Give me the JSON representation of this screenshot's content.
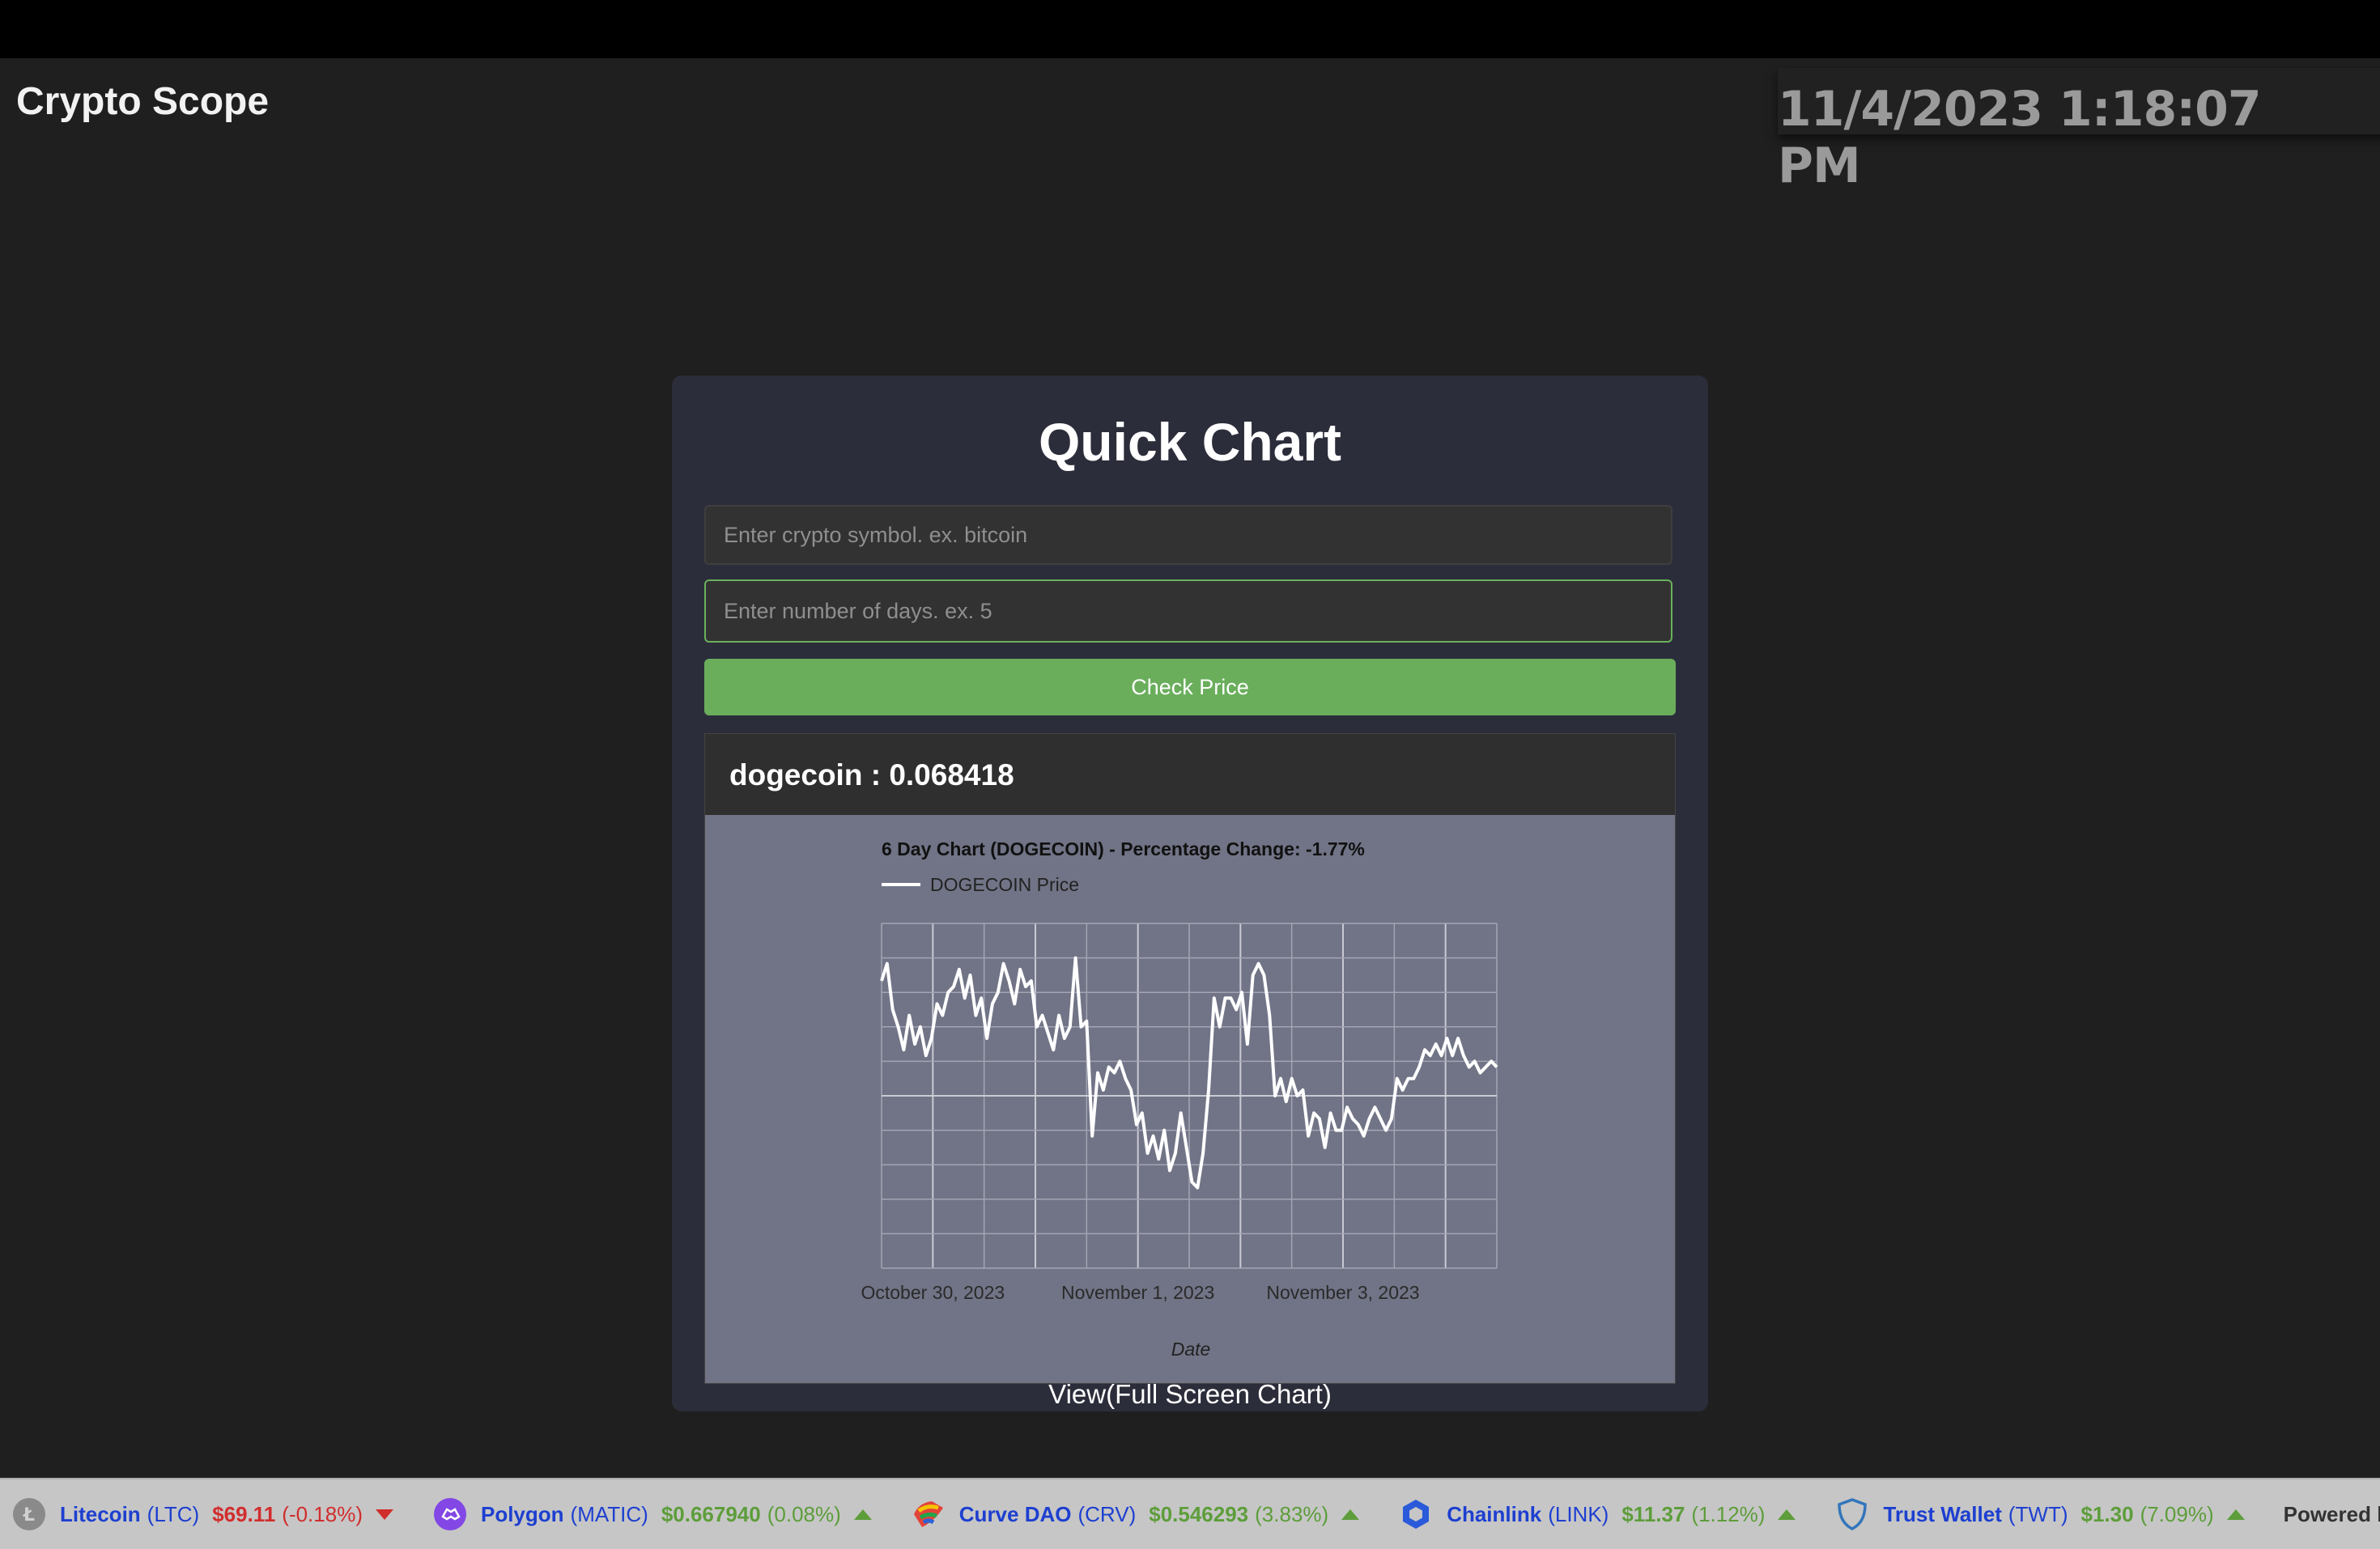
{
  "app": {
    "brand": "Crypto Scope",
    "datetime": "11/4/2023 1:18:07 PM"
  },
  "quick_chart": {
    "title": "Quick Chart",
    "symbol_placeholder": "Enter crypto symbol. ex. bitcoin",
    "days_placeholder": "Enter number of days. ex. 5",
    "check_button": "Check Price",
    "result_text": "dogecoin : 0.068418",
    "fullscreen_link": "View(Full Screen Chart)"
  },
  "chart_data": {
    "type": "line",
    "title": "6 Day Chart (DOGECOIN) - Percentage Change: -1.77%",
    "legend": "DOGECOIN Price",
    "xlabel": "Date",
    "x_ticks": [
      "October 30, 2023",
      "November 1, 2023",
      "November 3, 2023"
    ],
    "series_color": "#ffffff",
    "grid": true,
    "series": [
      {
        "name": "DOGECOIN Price",
        "values": [
          0.07,
          0.0703,
          0.0695,
          0.0692,
          0.0688,
          0.0694,
          0.0689,
          0.0692,
          0.0687,
          0.069,
          0.0696,
          0.0694,
          0.0698,
          0.0699,
          0.0702,
          0.0697,
          0.0701,
          0.0694,
          0.0697,
          0.069,
          0.0696,
          0.0698,
          0.0703,
          0.07,
          0.0696,
          0.0702,
          0.0699,
          0.07,
          0.0692,
          0.0694,
          0.0691,
          0.0688,
          0.0694,
          0.069,
          0.0692,
          0.0704,
          0.0692,
          0.0693,
          0.0673,
          0.0684,
          0.0681,
          0.0685,
          0.0684,
          0.0686,
          0.0683,
          0.0681,
          0.0675,
          0.0677,
          0.067,
          0.0673,
          0.0669,
          0.0674,
          0.0667,
          0.067,
          0.0677,
          0.0671,
          0.0665,
          0.0664,
          0.067,
          0.0681,
          0.0697,
          0.0692,
          0.0697,
          0.0697,
          0.0695,
          0.0698,
          0.0689,
          0.0701,
          0.0703,
          0.0701,
          0.0694,
          0.068,
          0.0683,
          0.0679,
          0.0683,
          0.068,
          0.0681,
          0.0673,
          0.0677,
          0.0676,
          0.0671,
          0.0677,
          0.0674,
          0.0674,
          0.0678,
          0.0676,
          0.0675,
          0.0673,
          0.0676,
          0.0678,
          0.0676,
          0.0674,
          0.0676,
          0.0683,
          0.0681,
          0.0683,
          0.0683,
          0.0685,
          0.0688,
          0.0687,
          0.0689,
          0.0687,
          0.069,
          0.0687,
          0.069,
          0.0687,
          0.0685,
          0.0686,
          0.0684,
          0.0685,
          0.0686,
          0.0685
        ]
      }
    ],
    "ylim": [
      0.065,
      0.071
    ]
  },
  "ticker": {
    "items": [
      {
        "name": "Litecoin",
        "symbol": "(LTC)",
        "price": "$69.11",
        "change": "(-0.18%)",
        "direction": "down",
        "icon": "litecoin-icon",
        "color": "#8a8a8a"
      },
      {
        "name": "Polygon",
        "symbol": "(MATIC)",
        "price": "$0.667940",
        "change": "(0.08%)",
        "direction": "up",
        "icon": "polygon-icon",
        "color": "#8247e5"
      },
      {
        "name": "Curve DAO",
        "symbol": "(CRV)",
        "price": "$0.546293",
        "change": "(3.83%)",
        "direction": "up",
        "icon": "curve-icon",
        "color": "#e3433a"
      },
      {
        "name": "Chainlink",
        "symbol": "(LINK)",
        "price": "$11.37",
        "change": "(1.12%)",
        "direction": "up",
        "icon": "chainlink-icon",
        "color": "#2a5ada"
      },
      {
        "name": "Trust Wallet",
        "symbol": "(TWT)",
        "price": "$1.30",
        "change": "(7.09%)",
        "direction": "up",
        "icon": "trust-wallet-icon",
        "color": "#3375bb"
      }
    ],
    "powered_by": "Powered by"
  }
}
